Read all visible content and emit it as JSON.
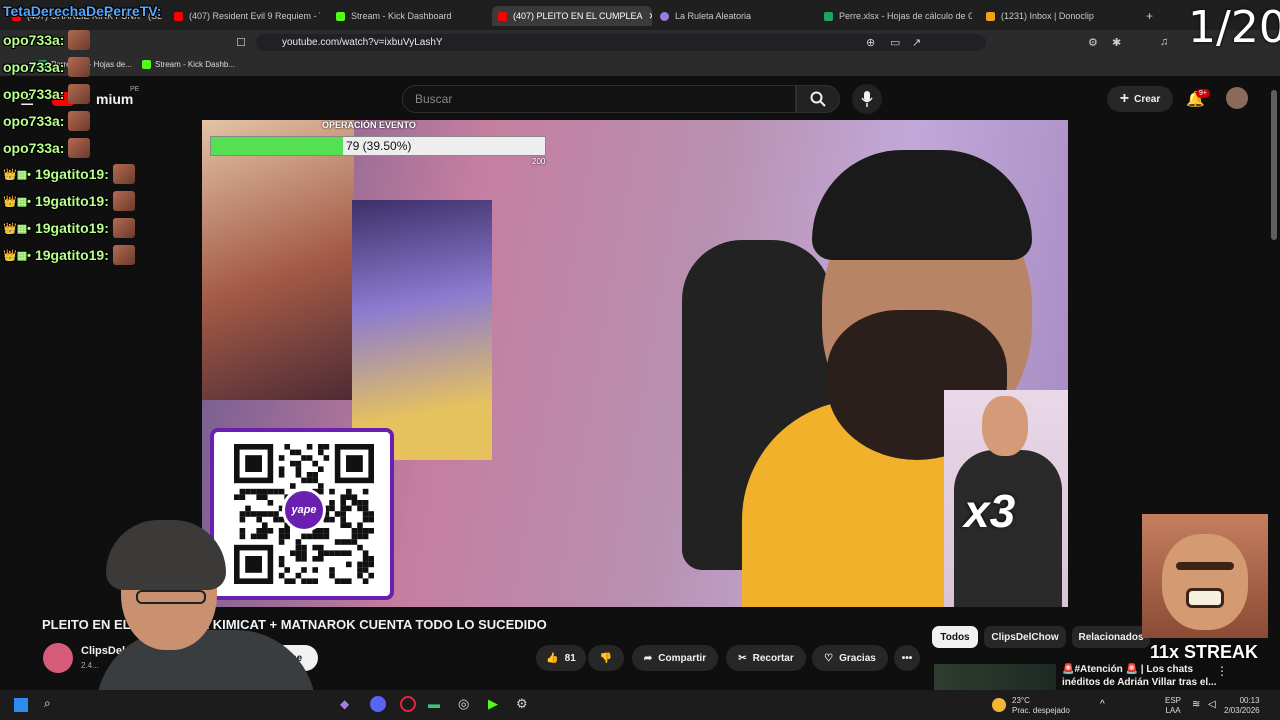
{
  "browser": {
    "tabs": [
      {
        "label": "(407) CHARLIE KIRK FUNK - (SLOW)",
        "color": "#ff0000"
      },
      {
        "label": "(407) Resident Evil 9 Requiem - Todo",
        "color": "#ff0000"
      },
      {
        "label": "Stream - Kick Dashboard",
        "color": "#53fc18"
      },
      {
        "label": "(407) PLEITO EN EL CUMPLEA",
        "color": "#ff0000"
      },
      {
        "label": "La Ruleta Aleatoria",
        "color": "#9b7be0"
      },
      {
        "label": "Perre.xlsx - Hojas de cálculo de Goog",
        "color": "#1fa463"
      },
      {
        "label": "(1231) Inbox | Donoclip",
        "color": "#f0a21b"
      }
    ],
    "url": "youtube.com/watch?v=ixbuVyLashY",
    "bookmarks": [
      "Perre.xlsx - Hojas de...",
      "Stream - Kick Dashb..."
    ]
  },
  "youtube": {
    "logo_text": "mium",
    "logo_sup": "PE",
    "search_placeholder": "Buscar",
    "create_label": "Crear",
    "notif_count": "9+",
    "title": "PLEITO EN EL C... ...OS DE KIMICAT + MATNAROK CUENTA TODO LO SUCEDIDO",
    "channel": "ClipsDel...",
    "subs": "2.4...",
    "subscribe_label": "me",
    "likes": "81",
    "share_label": "Compartir",
    "clip_label": "Recortar",
    "thanks_label": "Gracias",
    "chips": [
      "Todos",
      "ClipsDelChow",
      "Relacionados"
    ],
    "rec_title": "🚨#Atención 🚨 | Los chats inéditos de Adrián Villar tras el..."
  },
  "overlay": {
    "counter": "1/20",
    "goal_title": "OPERACIÓN EVENTO",
    "goal_value": 79,
    "goal_max": 200,
    "goal_text": "79 (39.50%)",
    "goal_max_label": "200",
    "chat": [
      {
        "user": "TetaDerechaDePerreTV:",
        "kind": "tv"
      },
      {
        "user": "opo733a:",
        "kind": "user"
      },
      {
        "user": "opo733a:",
        "kind": "user"
      },
      {
        "user": "opo733a:",
        "kind": "user"
      },
      {
        "user": "opo733a:",
        "kind": "user"
      },
      {
        "user": "opo733a:",
        "kind": "user"
      },
      {
        "user": "19gatito19:",
        "kind": "badge"
      },
      {
        "user": "19gatito19:",
        "kind": "badge"
      },
      {
        "user": "19gatito19:",
        "kind": "badge"
      },
      {
        "user": "19gatito19:",
        "kind": "badge"
      }
    ],
    "qr_label": "yape",
    "multiplier": "x3",
    "streak": "11x STREAK"
  },
  "taskbar": {
    "temp": "23°C",
    "weather": "Prac. despejado",
    "lang1": "ESP",
    "lang2": "LAA",
    "time": "00:13",
    "date": "2/03/2026"
  }
}
